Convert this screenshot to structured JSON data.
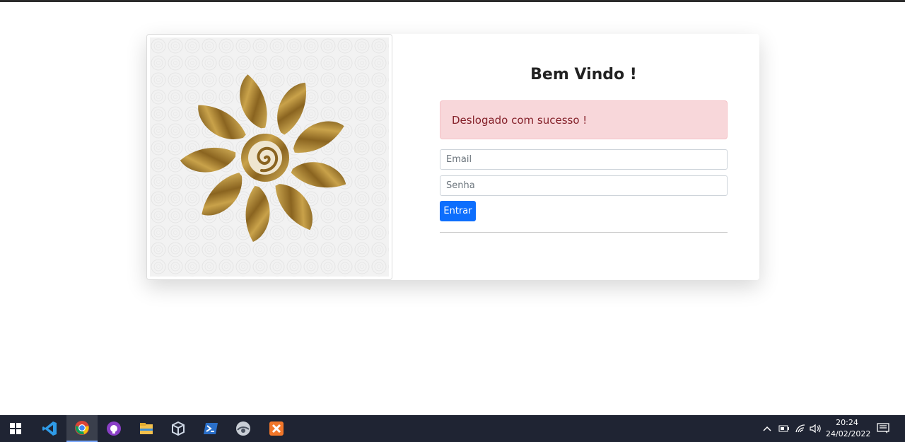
{
  "login": {
    "title": "Bem Vindo !",
    "alert_message": "Deslogado com sucesso !",
    "email_placeholder": "Email",
    "password_placeholder": "Senha",
    "submit_label": "Entrar",
    "alert_color": "#f8d7da",
    "button_color": "#0d6efd"
  },
  "taskbar": {
    "apps": [
      {
        "name": "windows-start-icon"
      },
      {
        "name": "vscode-icon"
      },
      {
        "name": "chrome-icon",
        "active": true
      },
      {
        "name": "github-desktop-icon"
      },
      {
        "name": "file-explorer-icon"
      },
      {
        "name": "virtualbox-icon"
      },
      {
        "name": "powershell-icon"
      },
      {
        "name": "mysql-workbench-icon"
      },
      {
        "name": "xampp-icon"
      }
    ],
    "time": "20:24",
    "date": "24/02/2022"
  }
}
